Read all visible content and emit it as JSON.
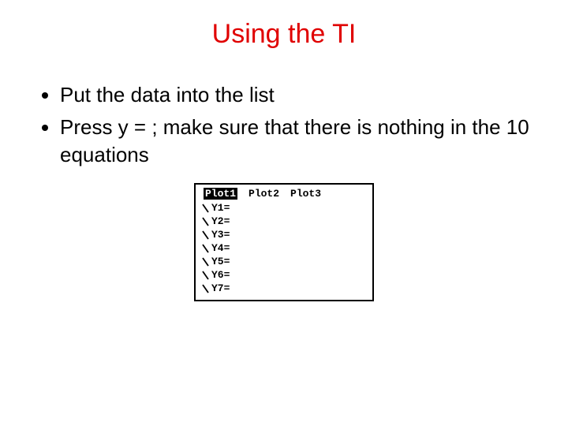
{
  "title": "Using the TI",
  "bullets": [
    "Put the data into the list",
    "Press y = ; make sure that there is nothing in the 10 equations"
  ],
  "calc": {
    "plots": [
      "Plot1",
      "Plot2",
      "Plot3"
    ],
    "selected_plot_index": 0,
    "equations": [
      "Y1=",
      "Y2=",
      "Y3=",
      "Y4=",
      "Y5=",
      "Y6=",
      "Y7="
    ]
  }
}
